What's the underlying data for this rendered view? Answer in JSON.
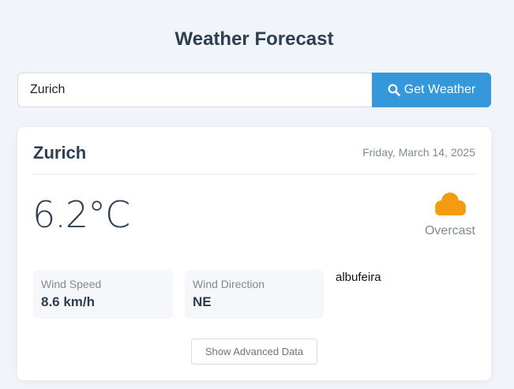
{
  "header": {
    "title": "Weather Forecast"
  },
  "search": {
    "value": "Zurich",
    "button_label": "Get Weather",
    "button_icon": "search-icon"
  },
  "weather": {
    "city": "Zurich",
    "date": "Friday, March 14, 2025",
    "temperature": "6.2°C",
    "condition": "Overcast",
    "condition_icon": "cloud-icon",
    "wind_speed_label": "Wind Speed",
    "wind_speed_value": "8.6 km/h",
    "wind_direction_label": "Wind Direction",
    "wind_direction_value": "NE",
    "extra_text": "albufeira",
    "advanced_button_label": "Show Advanced Data"
  },
  "colors": {
    "accent": "#3498db",
    "cloud": "#f39c12",
    "text": "#2c3e50",
    "muted": "#7f8c8d"
  }
}
